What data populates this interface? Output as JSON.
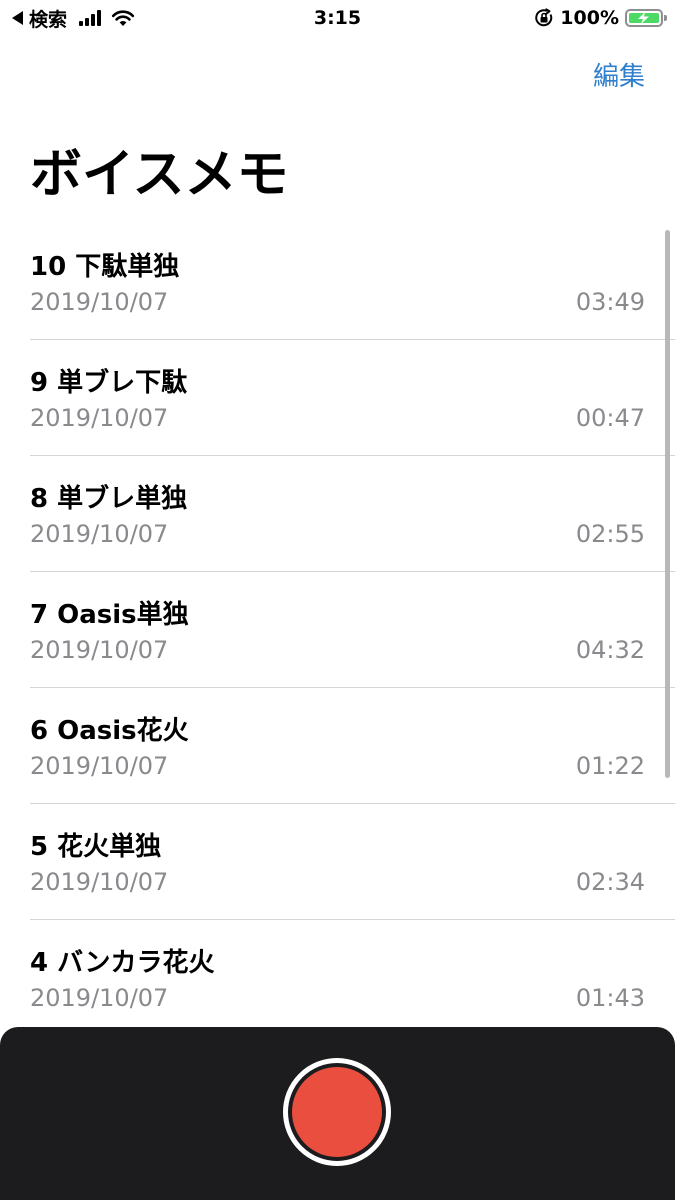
{
  "status_bar": {
    "back_label": "検索",
    "time": "3:15",
    "battery_text": "100%",
    "battery_level": 1.0,
    "icons": [
      "back-triangle-icon",
      "cellular-signal-icon",
      "wifi-icon",
      "orientation-lock-icon",
      "battery-charging-icon"
    ]
  },
  "header": {
    "edit_label": "編集",
    "title": "ボイスメモ"
  },
  "memos": [
    {
      "title": "10 下駄単独",
      "date": "2019/10/07",
      "duration": "03:49"
    },
    {
      "title": "9 単ブレ下駄",
      "date": "2019/10/07",
      "duration": "00:47"
    },
    {
      "title": "8 単ブレ単独",
      "date": "2019/10/07",
      "duration": "02:55"
    },
    {
      "title": "7 Oasis単独",
      "date": "2019/10/07",
      "duration": "04:32"
    },
    {
      "title": "6 Oasis花火",
      "date": "2019/10/07",
      "duration": "01:22"
    },
    {
      "title": "5 花火単独",
      "date": "2019/10/07",
      "duration": "02:34"
    },
    {
      "title": "4 バンカラ花火",
      "date": "2019/10/07",
      "duration": "01:43"
    }
  ],
  "colors": {
    "accent": "#2f7fcc",
    "record_red": "#e94e3f",
    "panel_bg": "#1c1c1e",
    "secondary_text": "#8a8a8e",
    "battery_green": "#4cd964"
  }
}
